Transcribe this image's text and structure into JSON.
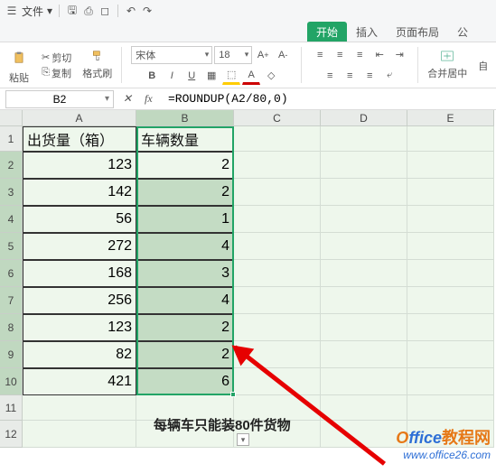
{
  "menubar": {
    "file": "文件",
    "dropdown": "▾"
  },
  "tabs": {
    "start": "开始",
    "insert": "插入",
    "layout": "页面布局",
    "formula": "公"
  },
  "ribbon": {
    "paste": "粘贴",
    "cut": "剪切",
    "copy": "复制",
    "format_painter": "格式刷",
    "font_name": "宋体",
    "font_size": "18",
    "merge": "合并居中",
    "auto": "自"
  },
  "formula_bar": {
    "cell_ref": "B2",
    "formula": "=ROUNDUP(A2/80,0)"
  },
  "columns": [
    "A",
    "B",
    "C",
    "D",
    "E"
  ],
  "headers": {
    "A": "出货量（箱）",
    "B": "车辆数量"
  },
  "rows": [
    {
      "n": 2,
      "a": "123",
      "b": "2"
    },
    {
      "n": 3,
      "a": "142",
      "b": "2"
    },
    {
      "n": 4,
      "a": "56",
      "b": "1"
    },
    {
      "n": 5,
      "a": "272",
      "b": "4"
    },
    {
      "n": 6,
      "a": "168",
      "b": "3"
    },
    {
      "n": 7,
      "a": "256",
      "b": "4"
    },
    {
      "n": 8,
      "a": "123",
      "b": "2"
    },
    {
      "n": 9,
      "a": "82",
      "b": "2"
    },
    {
      "n": 10,
      "a": "421",
      "b": "6"
    }
  ],
  "caption": "每辆车只能装80件货物",
  "watermark": {
    "brand1": "Office",
    "brand2": "教程网",
    "url": "www.office26.com"
  },
  "chart_data": {
    "type": "table",
    "title": "ROUNDUP vehicle count",
    "columns": [
      "出货量（箱）",
      "车辆数量"
    ],
    "data": [
      [
        123,
        2
      ],
      [
        142,
        2
      ],
      [
        56,
        1
      ],
      [
        272,
        4
      ],
      [
        168,
        3
      ],
      [
        256,
        4
      ],
      [
        123,
        2
      ],
      [
        82,
        2
      ],
      [
        421,
        6
      ]
    ],
    "note": "每辆车只能装80件货物"
  }
}
